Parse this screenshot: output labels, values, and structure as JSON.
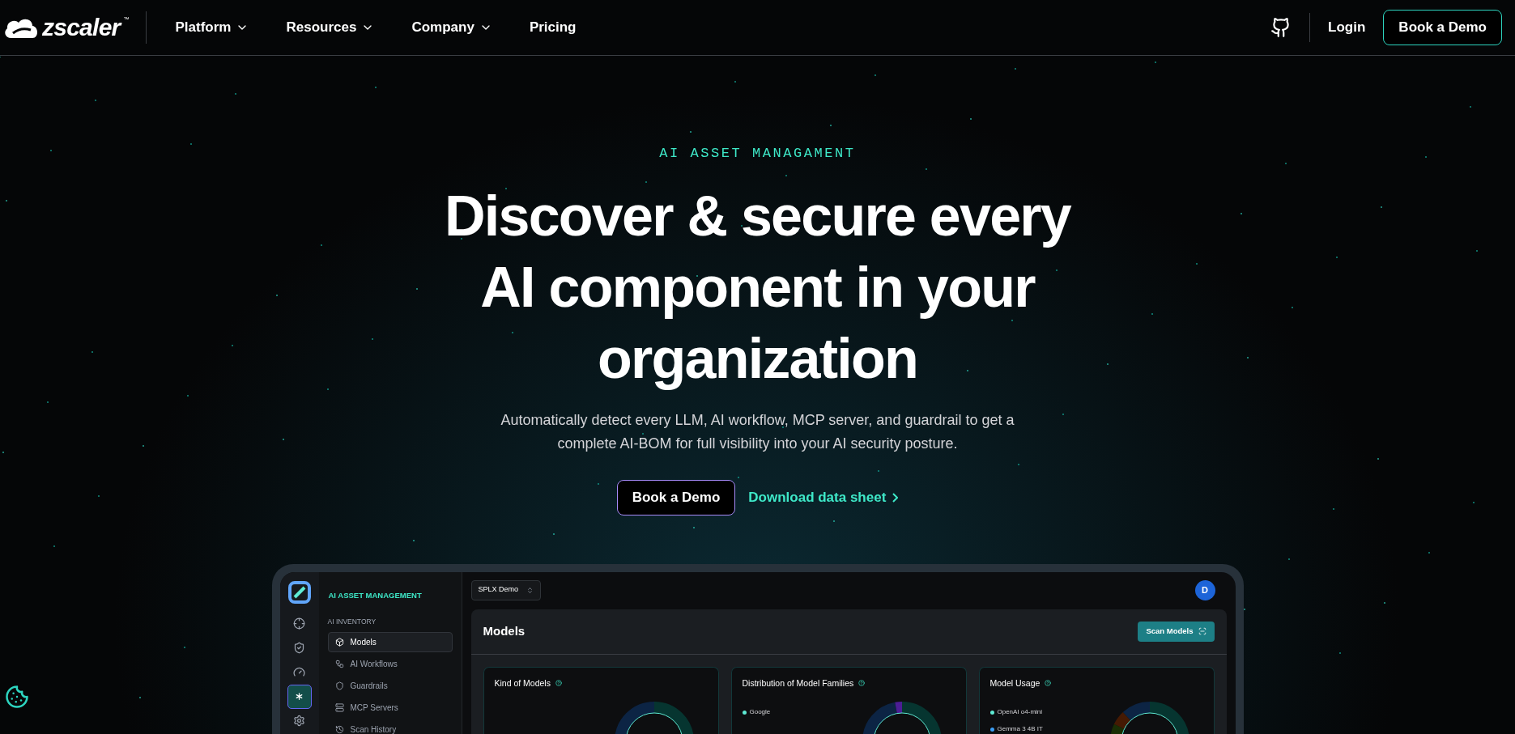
{
  "nav": {
    "logo": "zscaler",
    "trademark": "™",
    "menu": [
      {
        "label": "Platform",
        "dropdown": true
      },
      {
        "label": "Resources",
        "dropdown": true
      },
      {
        "label": "Company",
        "dropdown": true
      },
      {
        "label": "Pricing",
        "dropdown": false
      }
    ],
    "login": "Login",
    "cta": "Book a Demo"
  },
  "hero": {
    "eyebrow": "AI ASSET MANAGAMENT",
    "title": "Discover & secure every AI component in your organization",
    "subtitle": "Automatically detect every LLM, AI workflow, MCP server, and guardrail to get a complete AI-BOM for full visibility into your AI security posture.",
    "primary": "Book a Demo",
    "secondary": "Download data sheet"
  },
  "app": {
    "section": "AI ASSET MANAGEMENT",
    "group": "AI INVENTORY",
    "rail": [
      {
        "kind": "crosshair",
        "selected": false
      },
      {
        "kind": "shield",
        "selected": false
      },
      {
        "kind": "gauge",
        "selected": false
      },
      {
        "kind": "asterisk",
        "selected": true
      },
      {
        "kind": "settings",
        "selected": false
      }
    ],
    "items": [
      {
        "label": "Models",
        "selected": true
      },
      {
        "label": "AI Workflows",
        "selected": false
      },
      {
        "label": "Guardrails",
        "selected": false
      },
      {
        "label": "MCP Servers",
        "selected": false
      },
      {
        "label": "Scan History",
        "selected": false
      }
    ],
    "workspace": "SPLX Demo",
    "avatar": "D",
    "page_title": "Models",
    "scan_button": "Scan Models",
    "cards": [
      {
        "title": "Kind of Models"
      },
      {
        "title": "Distribution of Model Families",
        "legend": [
          {
            "label": "Google",
            "color": "#5eead4"
          }
        ]
      },
      {
        "title": "Model Usage",
        "legend": [
          {
            "label": "OpenAI o4-mini",
            "color": "#5eead4"
          },
          {
            "label": "Gemma 3 4B IT",
            "color": "#3b9ef5"
          }
        ]
      }
    ]
  }
}
